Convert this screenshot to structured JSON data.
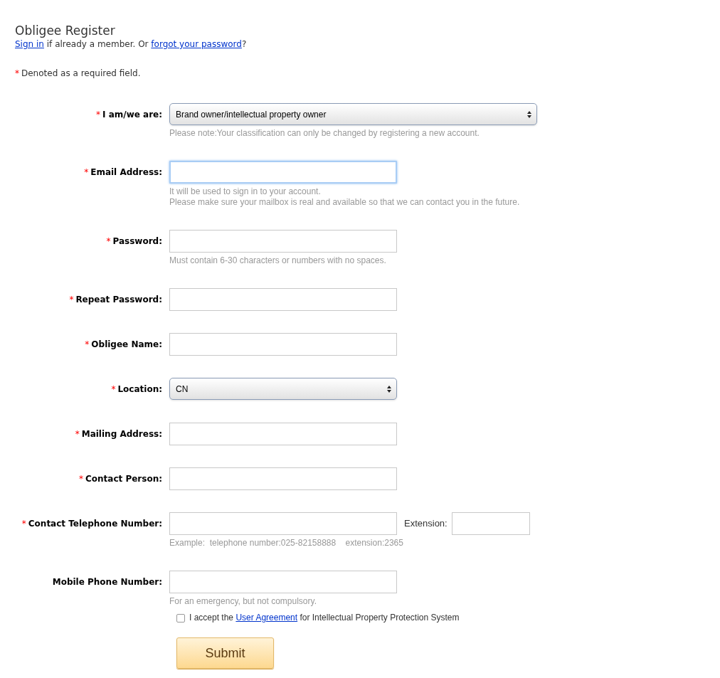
{
  "title": "Obligee Register",
  "intro": [
    {
      "kind": "link",
      "text": "Sign in"
    },
    {
      "kind": "text",
      "text": " if already a member. Or "
    },
    {
      "kind": "link",
      "text": "forgot your password"
    },
    {
      "kind": "text",
      "text": "?"
    }
  ],
  "required_note": {
    "mark": "*",
    "text": "Denoted as a required field."
  },
  "fields": [
    {
      "kind": "select",
      "label": "I am/we are:",
      "required": true,
      "value": "Brand owner/intellectual property owner",
      "wide": true,
      "hints": [
        "Please note:Your classification can only be changed by registering a new account."
      ]
    },
    {
      "kind": "input",
      "label": "Email Address:",
      "required": true,
      "focused": true,
      "hints": [
        "It will be used to sign in to your account.",
        "Please make sure your mailbox is real and available so that we can contact you in the future."
      ]
    },
    {
      "kind": "input",
      "label": "Password:",
      "required": true,
      "focused": false,
      "hints": [
        "Must contain 6-30 characters or numbers with no spaces."
      ]
    },
    {
      "kind": "input",
      "label": "Repeat Password:",
      "required": true,
      "focused": false
    },
    {
      "kind": "input",
      "label": "Obligee Name:",
      "required": true,
      "focused": false
    },
    {
      "kind": "select",
      "label": "Location:",
      "required": true,
      "value": "CN",
      "wide": false
    },
    {
      "kind": "input",
      "label": "Mailing Address:",
      "required": true,
      "focused": false
    },
    {
      "kind": "input",
      "label": "Contact Person:",
      "required": true,
      "focused": false
    },
    {
      "kind": "input",
      "label": "Contact Telephone Number:",
      "required": true,
      "focused": false,
      "extension": "Extension:",
      "hints": [
        "Example:  telephone number:025-82158888    extension:2365"
      ]
    },
    {
      "kind": "input",
      "label": "Mobile Phone Number:",
      "required": false,
      "focused": false,
      "hints": [
        "For an emergency, but not compulsory."
      ]
    }
  ],
  "agreement": {
    "checked": false,
    "parts": [
      {
        "kind": "text",
        "text": "I accept the "
      },
      {
        "kind": "link",
        "text": "User Agreement"
      },
      {
        "kind": "text",
        "text": " for Intellectual Property Protection System"
      }
    ]
  },
  "submit": "Submit"
}
